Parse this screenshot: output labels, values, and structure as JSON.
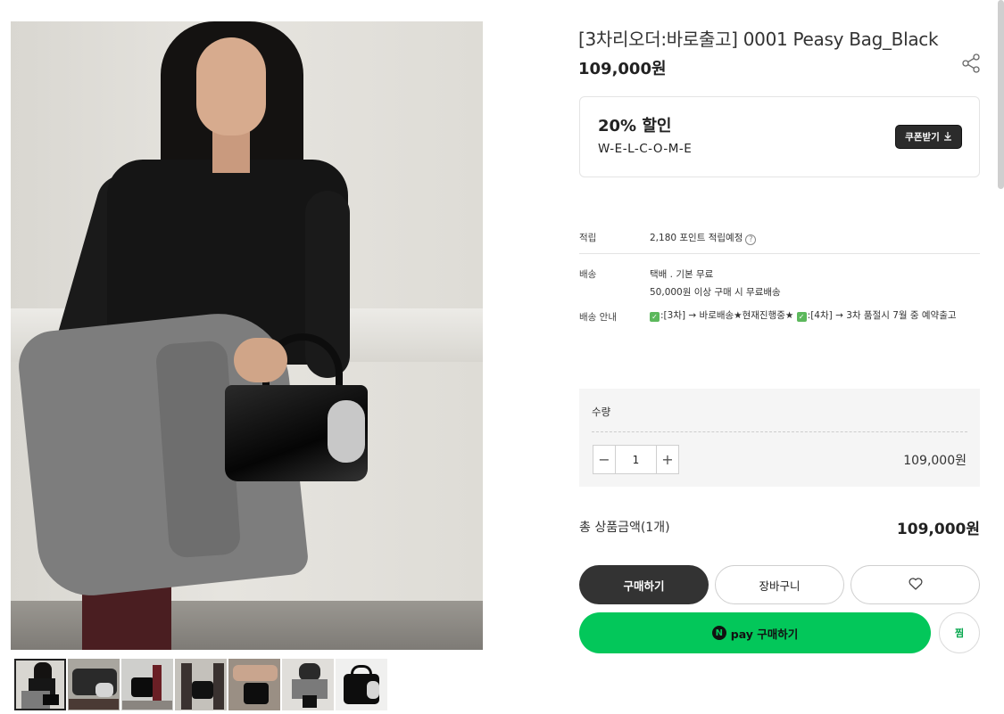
{
  "gallery": {
    "main_image": "model-with-black-tote-bag",
    "thumbnails": [
      "thumb-1",
      "thumb-2",
      "thumb-3",
      "thumb-4",
      "thumb-5",
      "thumb-6",
      "thumb-7"
    ],
    "active_thumbnail": 0
  },
  "product": {
    "title": "[3차리오더:바로출고] 0001 Peasy Bag_Black",
    "price": "109,000원",
    "share_icon": "share-icon"
  },
  "coupon": {
    "discount": "20% 할인",
    "code": "W-E-L-C-O-M-E",
    "button_label": "쿠폰받기",
    "button_icon": "download-icon"
  },
  "info": {
    "points_label": "적립",
    "points_value": "2,180 포인트 적립예정",
    "shipping_label": "배송",
    "shipping_line1": "택배 . 기본 무료",
    "shipping_line2": "50,000원 이상 구매 시 무료배송",
    "guide_label": "배송 안내",
    "guide_part1": ":[3차] → 바로배송★현재진행중★ ",
    "guide_part2": ":[4차] → 3차 품절시 7월 중 예약출고"
  },
  "quantity": {
    "label": "수량",
    "value": "1",
    "minus": "−",
    "plus": "+",
    "line_price": "109,000원"
  },
  "total": {
    "label": "총 상품금액(1개)",
    "price": "109,000원"
  },
  "actions": {
    "buy": "구매하기",
    "cart": "장바구니",
    "wishlist_icon": "heart-icon",
    "npay_logo": "N",
    "npay_label": "pay 구매하기",
    "zzim": "찜"
  },
  "colors": {
    "accent_dark": "#333333",
    "npay_green": "#03c75a",
    "check_green": "#5cb85c"
  }
}
